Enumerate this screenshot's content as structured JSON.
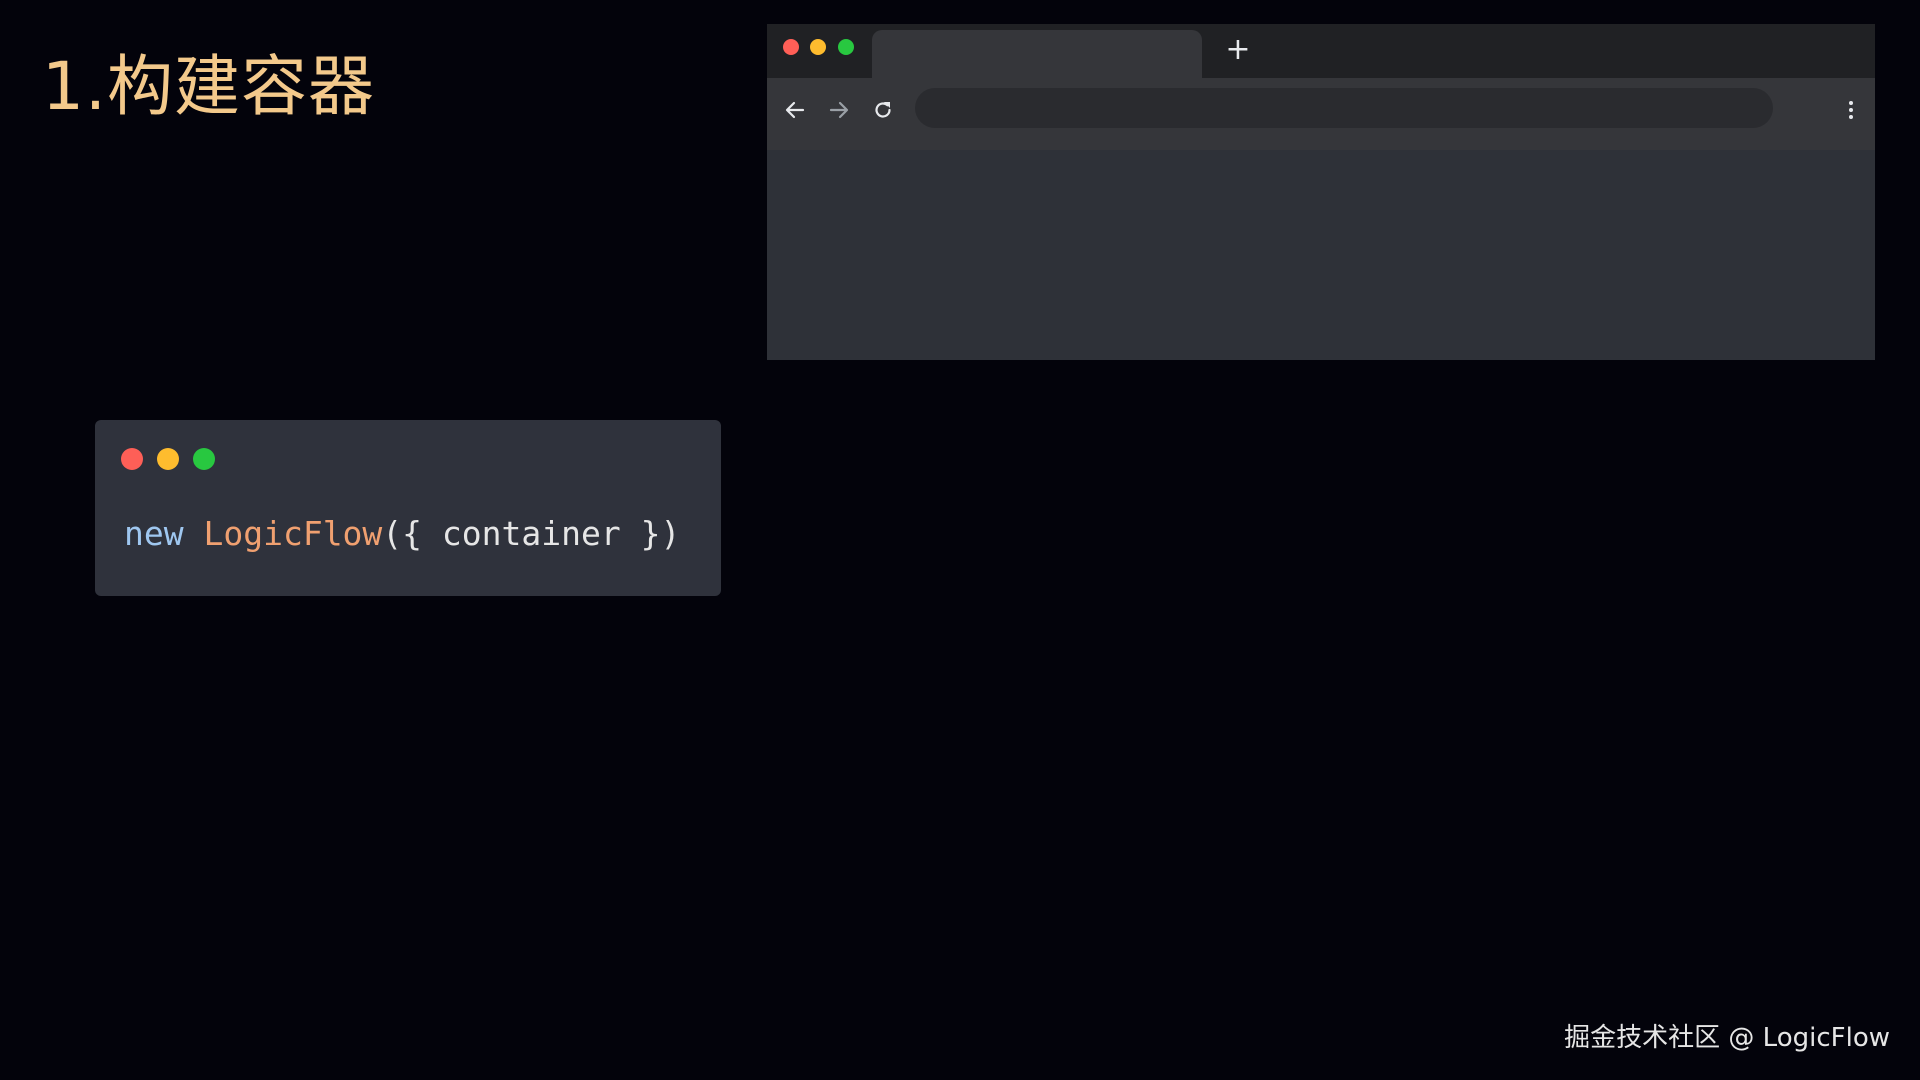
{
  "slide": {
    "title": "1.构建容器",
    "title_color": "#f3c98b",
    "background": "#03030b"
  },
  "browser": {
    "traffic_lights": [
      "#ff5f57",
      "#febc2e",
      "#28c840"
    ],
    "new_tab_glyph": "+",
    "back_icon": "arrow-left-icon",
    "forward_icon": "arrow-right-icon",
    "reload_icon": "reload-icon",
    "menu_icon": "kebab-menu-icon",
    "address_value": ""
  },
  "code": {
    "traffic_lights": [
      "#fe5f57",
      "#febc2e",
      "#28c840"
    ],
    "tokens": [
      {
        "text": "new",
        "color": "#9fc7f0"
      },
      {
        "text": " ",
        "color": "#e6e6e6"
      },
      {
        "text": "LogicFlow",
        "color": "#f0a070"
      },
      {
        "text": "({ container })",
        "color": "#e6e6e6"
      }
    ]
  },
  "footer": {
    "credit": "掘金技术社区 @ LogicFlow"
  }
}
